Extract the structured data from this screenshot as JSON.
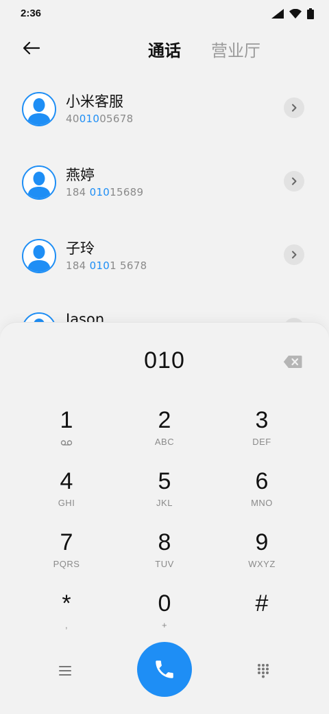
{
  "status_bar": {
    "time": "2:36"
  },
  "header": {
    "tabs": [
      {
        "label": "通话"
      },
      {
        "label": "营业厅"
      }
    ]
  },
  "contacts": [
    {
      "name": "小米客服",
      "number_prefix": "40",
      "number_match": "010",
      "number_suffix": "05678"
    },
    {
      "name": "燕婷",
      "number_prefix": "184 ",
      "number_match": "010",
      "number_suffix": "15689"
    },
    {
      "name": "子玲",
      "number_prefix": "184 ",
      "number_match": "010",
      "number_suffix": "1 5678"
    },
    {
      "name": "Jason",
      "number_prefix": "",
      "number_match": "",
      "number_suffix": ""
    }
  ],
  "dialpad": {
    "dialed_number": "010",
    "keys": [
      {
        "digit": "1",
        "letters": ""
      },
      {
        "digit": "2",
        "letters": "ABC"
      },
      {
        "digit": "3",
        "letters": "DEF"
      },
      {
        "digit": "4",
        "letters": "GHI"
      },
      {
        "digit": "5",
        "letters": "JKL"
      },
      {
        "digit": "6",
        "letters": "MNO"
      },
      {
        "digit": "7",
        "letters": "PQRS"
      },
      {
        "digit": "8",
        "letters": "TUV"
      },
      {
        "digit": "9",
        "letters": "WXYZ"
      },
      {
        "digit": "*",
        "letters": ","
      },
      {
        "digit": "0",
        "letters": "+"
      },
      {
        "digit": "#",
        "letters": ""
      }
    ]
  },
  "colors": {
    "accent": "#1e8ef5",
    "background": "#f2f2f2",
    "muted": "#8a8a8a"
  },
  "icons": {
    "back": "arrow-left-icon",
    "detail": "chevron-right-icon",
    "backspace": "backspace-icon",
    "voicemail": "voicemail-icon",
    "menu": "menu-icon",
    "call": "phone-icon",
    "keypad": "dialpad-icon"
  }
}
